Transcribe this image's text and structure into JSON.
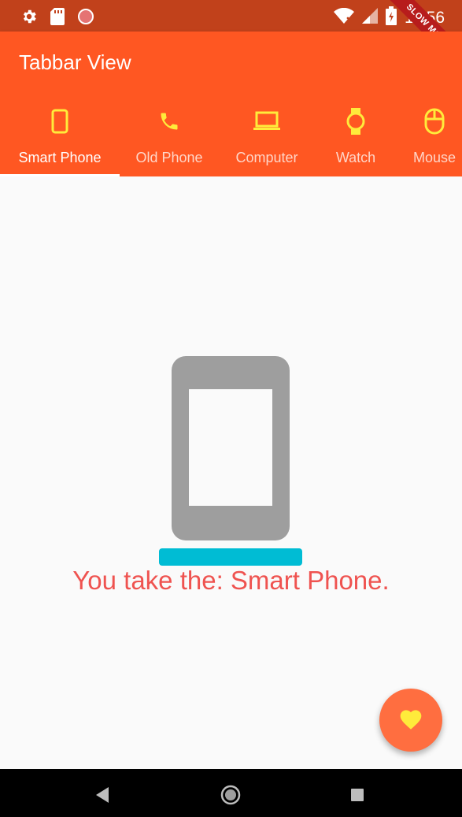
{
  "status_bar": {
    "time": "11:56",
    "ribbon_label": "SLOW MODE",
    "icons": [
      "gear-icon",
      "sd-card-icon",
      "record-icon",
      "wifi-icon",
      "signal-icon",
      "battery-icon"
    ]
  },
  "app_bar": {
    "title": "Tabbar View"
  },
  "tabs": [
    {
      "label": "Smart Phone",
      "icon": "smartphone-icon",
      "active": true
    },
    {
      "label": "Old Phone",
      "icon": "phone-icon",
      "active": false
    },
    {
      "label": "Computer",
      "icon": "laptop-icon",
      "active": false
    },
    {
      "label": "Watch",
      "icon": "watch-icon",
      "active": false
    },
    {
      "label": "Mouse",
      "icon": "mouse-icon",
      "active": false
    }
  ],
  "content": {
    "illustration": "smartphone-icon",
    "message": "You take the: Smart Phone."
  },
  "fab": {
    "icon": "heart-icon"
  },
  "navigation": {
    "icons": [
      "back-icon",
      "home-icon",
      "recents-icon"
    ]
  },
  "colors": {
    "primary": "#ff5722",
    "status_bar": "#c1411b",
    "tab_icon": "#ffeb3b",
    "message": "#ef5350",
    "dock_bar": "#00bcd4",
    "fab": "#ff6e40",
    "fab_icon": "#ffeb3b"
  }
}
